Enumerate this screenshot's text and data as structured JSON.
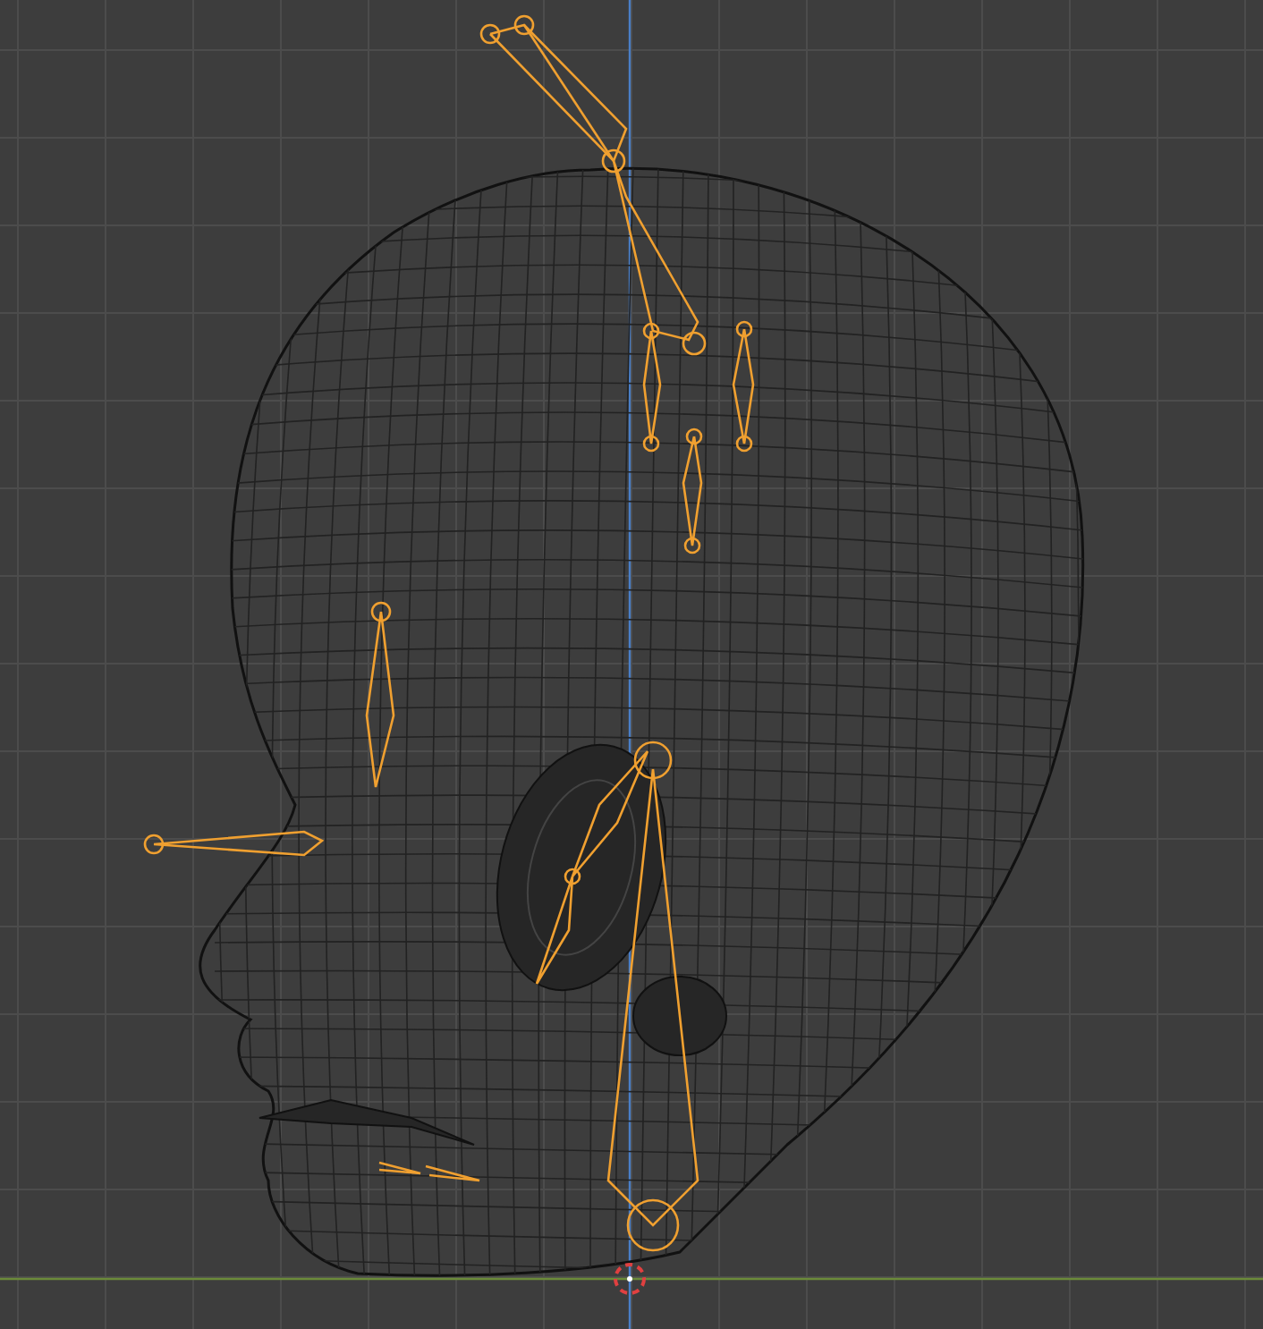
{
  "viewport": {
    "wireframe": true,
    "show_grid": true,
    "show_cursor": true
  },
  "armature": {
    "selected": true
  }
}
